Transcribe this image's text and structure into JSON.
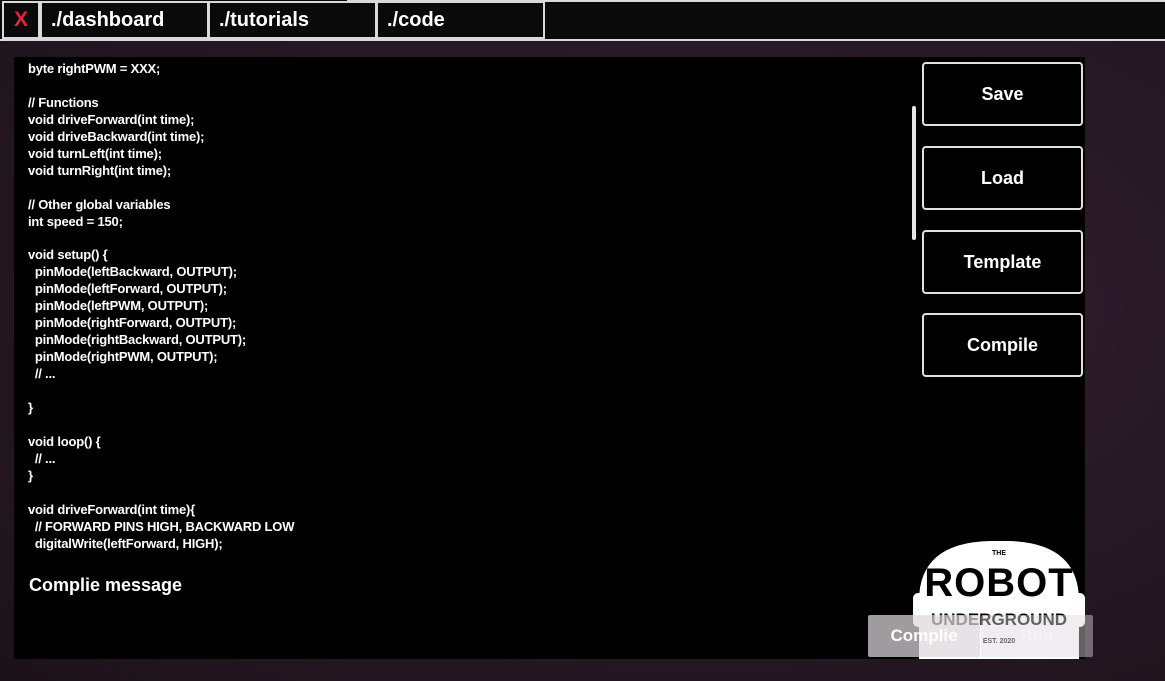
{
  "nav": {
    "close_label": "X",
    "tabs": [
      {
        "label": "./dashboard"
      },
      {
        "label": "./tutorials"
      },
      {
        "label": "./code"
      }
    ]
  },
  "editor": {
    "code": "// PWMs\nbyte rightPWM = XXX;\n\n// Functions\nvoid driveForward(int time);\nvoid driveBackward(int time);\nvoid turnLeft(int time);\nvoid turnRight(int time);\n\n// Other global variables\nint speed = 150;\n\nvoid setup() {\n  pinMode(leftBackward, OUTPUT);\n  pinMode(leftForward, OUTPUT);\n  pinMode(leftPWM, OUTPUT);\n  pinMode(rightForward, OUTPUT);\n  pinMode(rightBackward, OUTPUT);\n  pinMode(rightPWM, OUTPUT);\n  // ...\n\n}\n\nvoid loop() {\n  // ...\n}\n\nvoid driveForward(int time){\n  // FORWARD PINS HIGH, BACKWARD LOW\n  digitalWrite(leftForward, HIGH);"
  },
  "side_buttons": {
    "save": "Save",
    "load": "Load",
    "template": "Template",
    "compile": "Compile"
  },
  "compile_message": {
    "label": "Complie message"
  },
  "logo": {
    "the": "THE",
    "robot": "ROBOT",
    "underground": "UNDERGROUND",
    "est": "EST. 2020"
  },
  "bottom_buttons": {
    "compile_1": "Complie",
    "compile_2": "Run"
  },
  "colors": {
    "background": "#2a1a28",
    "panel": "#000000",
    "close_x": "#e0243a",
    "border": "#e0e0e0"
  }
}
